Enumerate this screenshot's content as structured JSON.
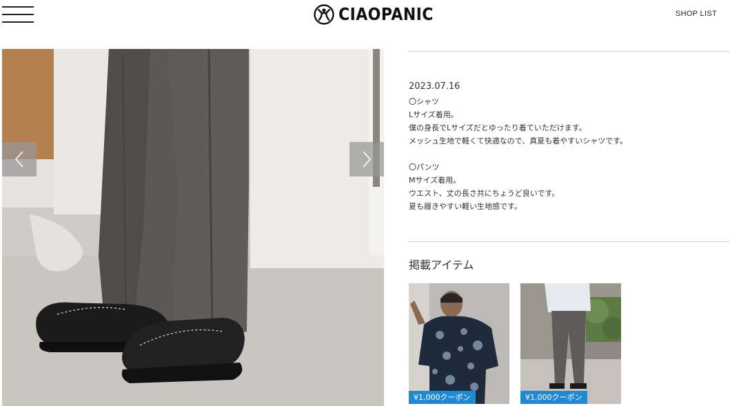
{
  "header": {
    "logo_text": "CIAOPANIC",
    "shop_list_label": "SHOP LIST"
  },
  "post": {
    "date": "2023.07.16",
    "description_lines": [
      "〇シャツ",
      "Lサイズ着用。",
      "僕の身長でLサイズだとゆったり着ていただけます。",
      "メッシュ生地で軽くて快適なので、真夏も着やすいシャツです。",
      "",
      "〇パンツ",
      "Mサイズ着用。",
      "ウエスト、丈の長さ共にちょうど良いです。",
      "夏も履きやすい軽い生地感です。"
    ]
  },
  "items_section": {
    "heading": "掲載アイテム",
    "items": [
      {
        "coupon_label": "¥1,000クーポン"
      },
      {
        "coupon_label": "¥1,000クーポン"
      }
    ]
  },
  "colors": {
    "coupon_bg": "#1f8ad1",
    "divider": "#d0d0d0"
  }
}
